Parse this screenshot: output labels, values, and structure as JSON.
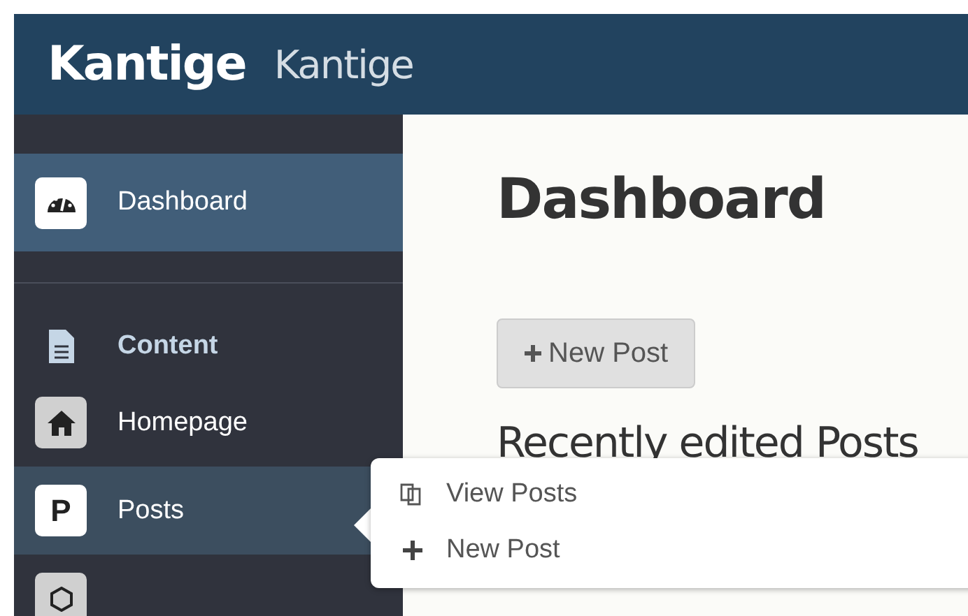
{
  "header": {
    "brand": "Kantige",
    "site_name": "Kantige"
  },
  "sidebar": {
    "items": [
      {
        "kind": "link",
        "label": "Dashboard",
        "selected": true,
        "hovered": false
      },
      {
        "kind": "section",
        "label": "Content",
        "selected": false,
        "hovered": false
      },
      {
        "kind": "link",
        "label": "Homepage",
        "selected": false,
        "hovered": false
      },
      {
        "kind": "link",
        "icon_text": "P",
        "label": "Posts",
        "selected": false,
        "hovered": true
      },
      {
        "kind": "link",
        "selected": false,
        "hovered": false
      }
    ]
  },
  "main": {
    "title": "Dashboard",
    "new_post_button": "New Post",
    "section_title": "Recently edited Posts"
  },
  "popup_menu": {
    "items": [
      {
        "label": "View Posts"
      },
      {
        "label": "New Post"
      }
    ]
  }
}
